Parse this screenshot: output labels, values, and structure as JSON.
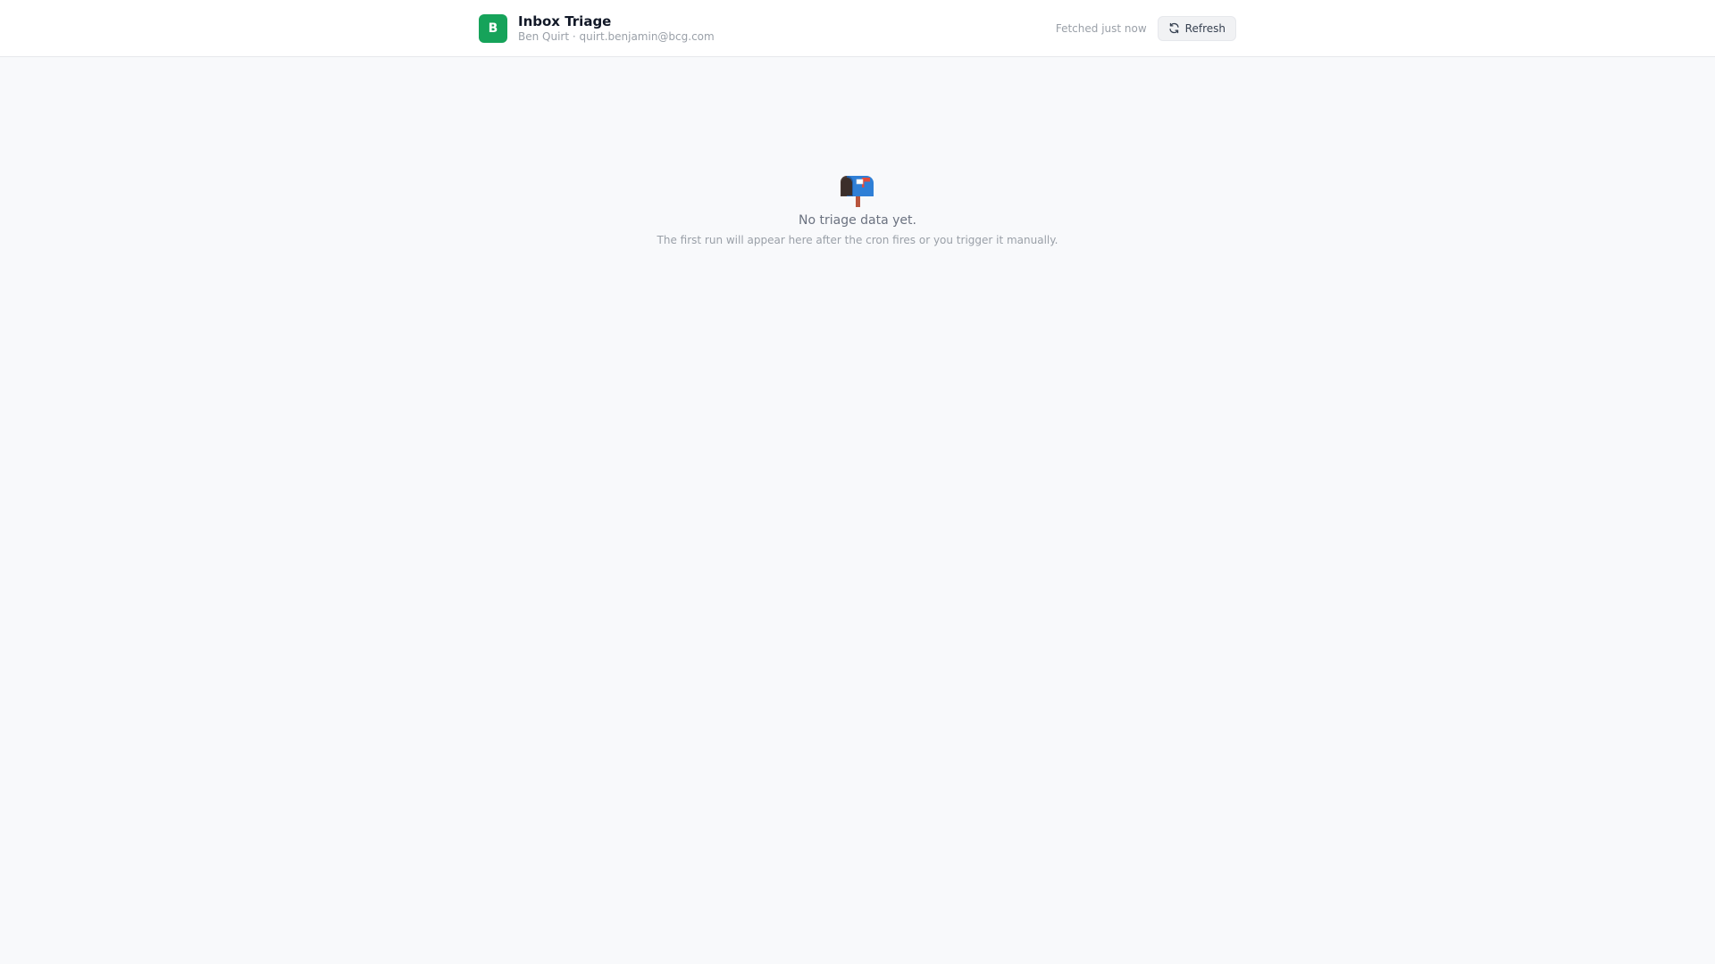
{
  "header": {
    "avatar_letter": "B",
    "title": "Inbox Triage",
    "user_line": "Ben Quirt · quirt.benjamin@bcg.com",
    "fetched_status": "Fetched just now",
    "refresh_label": "Refresh",
    "accent_color": "#16a35a"
  },
  "empty_state": {
    "icon": "mailbox-icon",
    "title": "No triage data yet.",
    "subtitle": "The first run will appear here after the cron fires or you trigger it manually."
  }
}
